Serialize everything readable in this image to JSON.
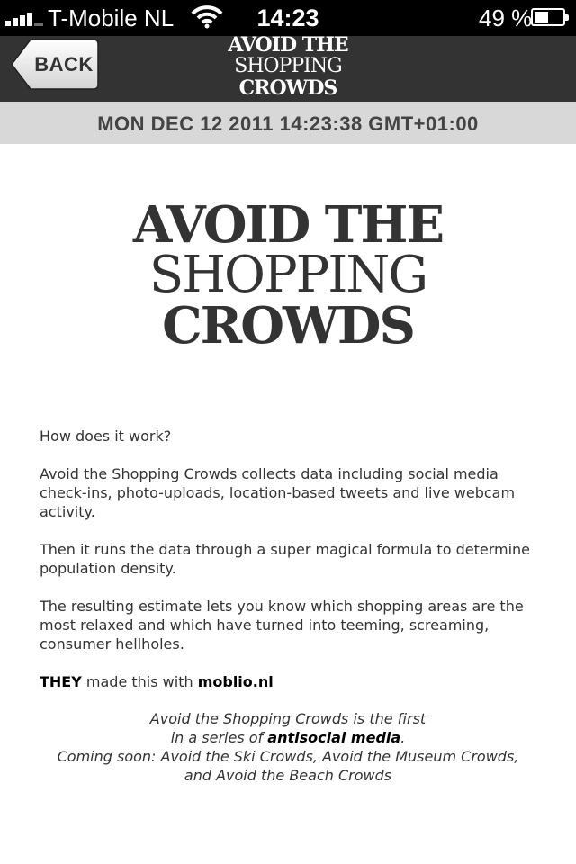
{
  "status_bar": {
    "carrier": "T-Mobile NL",
    "time": "14:23",
    "battery_percent": "49 %",
    "battery_level": 0.49,
    "signal_bars": 4
  },
  "nav": {
    "back_label": "BACK",
    "logo_line1": "AVOID THE",
    "logo_line2": "SHOPPING",
    "logo_line3": "CROWDS"
  },
  "date_strip": "MON DEC 12 2011 14:23:38 GMT+01:00",
  "hero": {
    "line1": "AVOID THE",
    "line2": "SHOPPING",
    "line3": "CROWDS"
  },
  "content": {
    "question": "How does it work?",
    "para1": "Avoid the Shopping Crowds collects data including social media check-ins, photo-uploads, location-based tweets and live webcam activity.",
    "para2": "Then it runs the data through a super magical formula to determine population density.",
    "para3": "The resulting estimate lets you know which shopping areas are the most relaxed and which have turned into teeming, screaming, consumer hellholes.",
    "credit_prefix": "THEY",
    "credit_middle": " made this with ",
    "credit_link": "moblio.nl"
  },
  "footer": {
    "line1": "Avoid the Shopping Crowds is the first",
    "line2_prefix": "in a series of ",
    "line2_emph": "antisocial media",
    "line2_suffix": ".",
    "line3": "Coming soon: Avoid the Ski Crowds, Avoid the Museum Crowds,",
    "line4": "and Avoid the Beach Crowds"
  },
  "colors": {
    "nav_background": "#333333",
    "date_strip_background": "#d8d8d8",
    "text": "#333333"
  }
}
